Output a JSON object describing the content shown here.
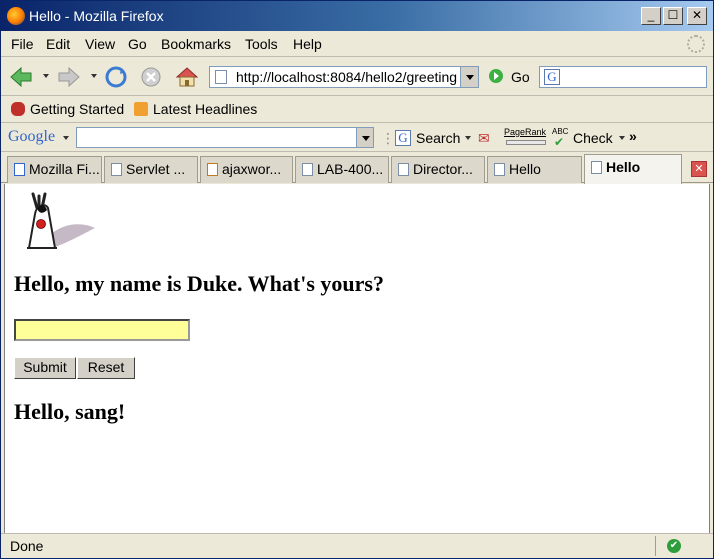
{
  "window": {
    "title": "Hello - Mozilla Firefox",
    "controls": {
      "minimize": "_",
      "maximize": "☐",
      "close": "✕"
    }
  },
  "menubar": {
    "items": [
      "File",
      "Edit",
      "View",
      "Go",
      "Bookmarks",
      "Tools",
      "Help"
    ]
  },
  "navbar": {
    "url": "http://localhost:8084/hello2/greeting",
    "go_label": "Go",
    "search_value": ""
  },
  "bookmarks": {
    "items": [
      "Getting Started",
      "Latest Headlines"
    ]
  },
  "google_toolbar": {
    "logo": "Google",
    "search_value": "",
    "search_label": "Search",
    "pagerank_label": "PageRank",
    "abc_label": "ABC",
    "check_label": "Check",
    "more": "»"
  },
  "tabs": [
    {
      "label": "Mozilla Fi...",
      "active": false
    },
    {
      "label": "Servlet ...",
      "active": false
    },
    {
      "label": "ajaxwor...",
      "active": false
    },
    {
      "label": "LAB-400...",
      "active": false
    },
    {
      "label": "Director...",
      "active": false
    },
    {
      "label": "Hello",
      "active": false
    },
    {
      "label": "Hello",
      "active": true
    }
  ],
  "page": {
    "heading": "Hello, my name is Duke. What's yours?",
    "name_input_value": "",
    "submit_label": "Submit",
    "reset_label": "Reset",
    "reply": "Hello, sang!"
  },
  "statusbar": {
    "text": "Done"
  },
  "colors": {
    "titlebar_start": "#0a246a",
    "input_background": "#ffff99",
    "chrome": "#ece9d8"
  }
}
